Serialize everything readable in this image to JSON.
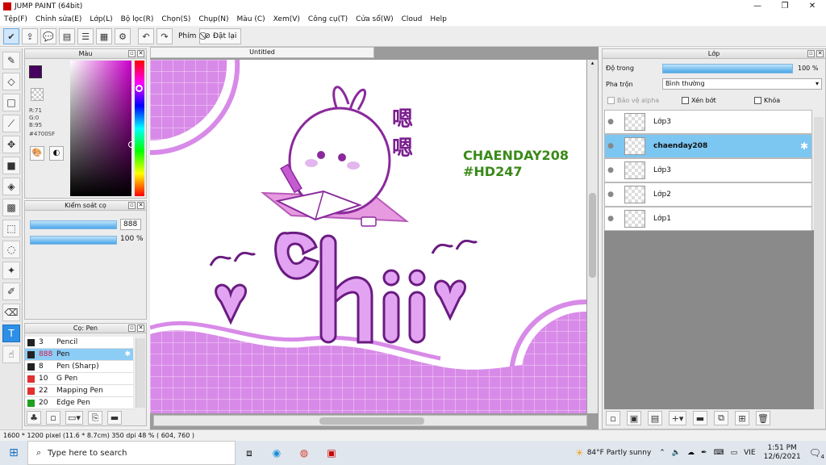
{
  "app": {
    "title": "JUMP PAINT (64bit)"
  },
  "window_controls": {
    "minimize": "—",
    "maximize": "❐",
    "close": "✕"
  },
  "menu": [
    "Tệp(F)",
    "Chỉnh sửa(E)",
    "Lớp(L)",
    "Bộ lọc(R)",
    "Chọn(S)",
    "Chụp(N)",
    "Màu (C)",
    "Xem(V)",
    "Công cụ(T)",
    "Cửa sổ(W)",
    "Cloud",
    "Help"
  ],
  "toolbar": {
    "phim_label": "Phím",
    "reset_label": "Đặt lại"
  },
  "color_panel": {
    "title": "Màu",
    "r": "R:71",
    "g": "G:0",
    "b": "B:95",
    "hex": "#4700SF",
    "main_color": "#47005f"
  },
  "brush_control": {
    "title": "Kiểm soát cọ",
    "size_value": "888",
    "opacity_value": "100 %"
  },
  "brush_panel": {
    "title": "Cọ: Pen",
    "items": [
      {
        "size": "3",
        "name": "Pencil",
        "color": "#222222"
      },
      {
        "size": "888",
        "name": "Pen",
        "color": "#222222",
        "selected": true
      },
      {
        "size": "8",
        "name": "Pen (Sharp)",
        "color": "#222222"
      },
      {
        "size": "10",
        "name": "G Pen",
        "color": "#e03030"
      },
      {
        "size": "22",
        "name": "Mapping Pen",
        "color": "#e03030"
      },
      {
        "size": "20",
        "name": "Edge Pen",
        "color": "#20a020"
      }
    ]
  },
  "document": {
    "tab_title": "Untitled"
  },
  "artwork": {
    "watermark_line1": "CHAENDAY208",
    "watermark_line2": "#HD247",
    "chinese_text": "嗯嗯",
    "big_text": "ch i i"
  },
  "layers_panel": {
    "title": "Lớp",
    "opacity_label": "Độ trong",
    "opacity_value": "100 %",
    "blend_label": "Pha trộn",
    "blend_value": "Bình thường",
    "protect_alpha": "Bảo vệ alpha",
    "clip": "Xén bớt",
    "lock": "Khóa",
    "layers": [
      {
        "name": "Lớp3",
        "selected": false
      },
      {
        "name": "chaenday208",
        "selected": true
      },
      {
        "name": "Lớp3",
        "selected": false
      },
      {
        "name": "Lớp2",
        "selected": false
      },
      {
        "name": "Lớp1",
        "selected": false
      }
    ]
  },
  "status": {
    "text": "1600 * 1200 pixel   (11.6 * 8.7cm)   350 dpi   48 %   ( 604, 760 )"
  },
  "taskbar": {
    "search_placeholder": "Type here to search",
    "weather": "84°F  Partly sunny",
    "lang": "VIE",
    "time": "1:51 PM",
    "date": "12/6/2021",
    "notif": "4"
  }
}
